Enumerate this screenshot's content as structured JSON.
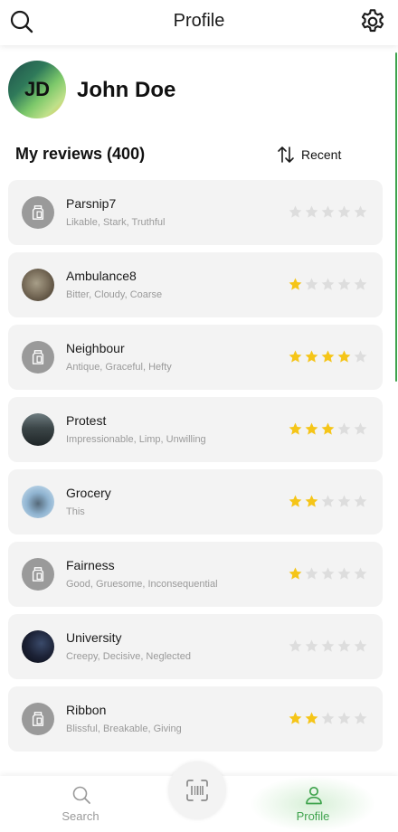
{
  "header": {
    "title": "Profile",
    "search_icon": "search-icon",
    "settings_icon": "gear-icon"
  },
  "profile": {
    "initials": "JD",
    "name": "John Doe"
  },
  "reviews": {
    "title": "My reviews (400)",
    "sort_label": "Recent",
    "sort_icon": "sort-arrows-icon",
    "items": [
      {
        "name": "Parsnip7",
        "tags": "Likable, Stark, Truthful",
        "rating": 0,
        "thumb": "placeholder"
      },
      {
        "name": "Ambulance8",
        "tags": "Bitter, Cloudy, Coarse",
        "rating": 1,
        "thumb": "photo-rock"
      },
      {
        "name": "Neighbour",
        "tags": "Antique, Graceful, Hefty",
        "rating": 4,
        "thumb": "placeholder"
      },
      {
        "name": "Protest",
        "tags": "Impressionable, Limp, Unwilling",
        "rating": 3,
        "thumb": "photo-forest"
      },
      {
        "name": "Grocery",
        "tags": "This",
        "rating": 2,
        "thumb": "photo-cat"
      },
      {
        "name": "Fairness",
        "tags": "Good, Gruesome, Inconsequential",
        "rating": 1,
        "thumb": "placeholder"
      },
      {
        "name": "University",
        "tags": "Creepy, Decisive, Neglected",
        "rating": 0,
        "thumb": "photo-night"
      },
      {
        "name": "Ribbon",
        "tags": "Blissful, Breakable, Giving",
        "rating": 2,
        "thumb": "placeholder"
      }
    ]
  },
  "bottom_nav": {
    "search_label": "Search",
    "profile_label": "Profile",
    "scan_icon": "barcode-scan-icon"
  },
  "colors": {
    "accent": "#3fa34d",
    "star_on": "#f5c518",
    "star_off": "#dddddd",
    "card_bg": "#f3f3f3"
  }
}
